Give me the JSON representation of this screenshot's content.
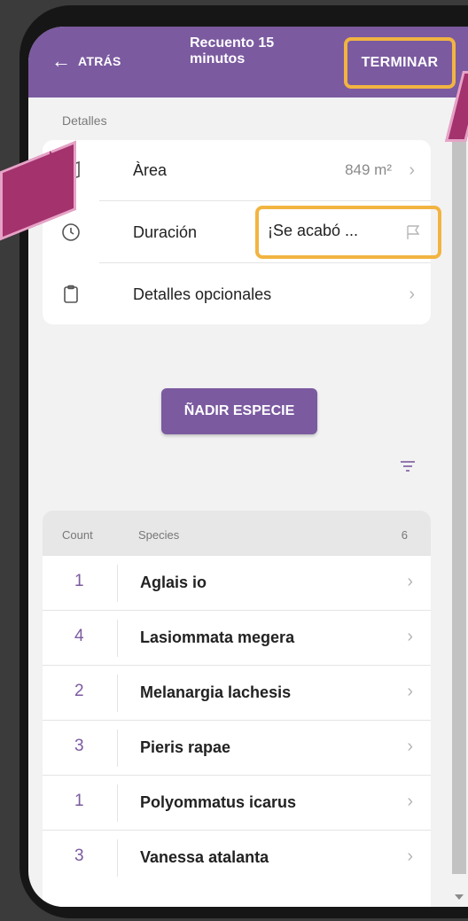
{
  "header": {
    "back_label": "ATRÁS",
    "title": "Recuento 15 minutos",
    "finish_label": "TERMINAR"
  },
  "details": {
    "section_label": "Detalles",
    "area": {
      "label": "Àrea",
      "value": "849 m²",
      "icon": "map-icon"
    },
    "duration": {
      "label": "Duración",
      "value": "¡Se acabó ...",
      "icon": "clock-icon"
    },
    "optional": {
      "label": "Detalles opcionales",
      "icon": "clipboard-icon"
    }
  },
  "add_species_label": "ÑADIR ESPECIE",
  "species_list": {
    "header_count": "Count",
    "header_species": "Species",
    "total": "6",
    "rows": [
      {
        "count": "1",
        "name": "Aglais io"
      },
      {
        "count": "4",
        "name": "Lasiommata megera"
      },
      {
        "count": "2",
        "name": "Melanargia lachesis"
      },
      {
        "count": "3",
        "name": "Pieris rapae"
      },
      {
        "count": "1",
        "name": "Polyommatus icarus"
      },
      {
        "count": "3",
        "name": "Vanessa atalanta"
      }
    ]
  },
  "colors": {
    "accent": "#7b5aa0",
    "highlight": "#f2b441",
    "callout": "#a3326d"
  }
}
